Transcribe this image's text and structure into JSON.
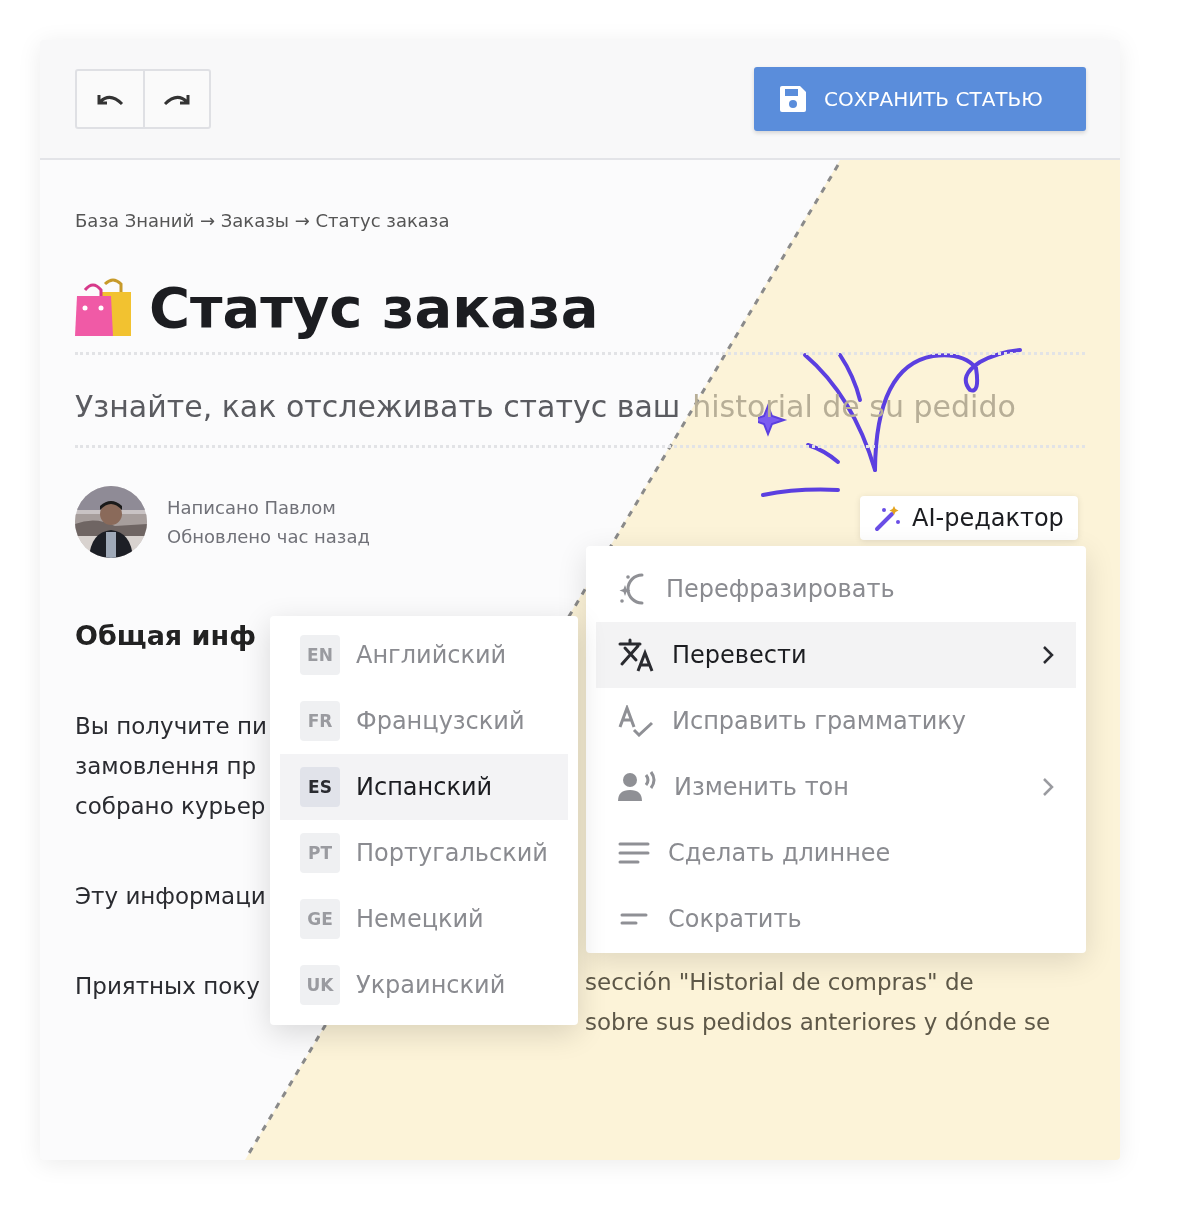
{
  "toolbar": {
    "save_button": "СОХРАНИТЬ СТАТЬЮ"
  },
  "breadcrumb": "База Знаний → Заказы → Статус заказа",
  "article": {
    "title": "Статус заказа",
    "subtitle": "Узнайте, как отслеживать статус ваш",
    "subtitle_translated": "historial de su pedido",
    "author": {
      "written_by": "Написано Павлом",
      "updated": "Обновлено час назад"
    },
    "section_heading": "Общая инф",
    "paragraphs": [
      [
        "Вы получите пи",
        "замовлення пр",
        "собрано курьер"
      ],
      [
        "Эту информаци"
      ],
      [
        "Приятных поку"
      ]
    ],
    "translated_lines": [
      "sección \"Historial de compras\" de",
      "sobre sus pedidos anteriores y dónde se"
    ]
  },
  "ai_editor": {
    "label": "AI-редактор"
  },
  "ai_menu": [
    {
      "kind": "rephrase",
      "label": "Перефразировать",
      "selected": false,
      "submenu": false
    },
    {
      "kind": "translate",
      "label": "Перевести",
      "selected": true,
      "submenu": true
    },
    {
      "kind": "grammar",
      "label": "Исправить грамматику",
      "selected": false,
      "submenu": false
    },
    {
      "kind": "tone",
      "label": "Изменить тон",
      "selected": false,
      "submenu": true
    },
    {
      "kind": "longer",
      "label": "Сделать длиннее",
      "selected": false,
      "submenu": false
    },
    {
      "kind": "shorter",
      "label": "Сократить",
      "selected": false,
      "submenu": false
    }
  ],
  "language_menu": [
    {
      "code": "EN",
      "label": "Английский",
      "selected": false
    },
    {
      "code": "FR",
      "label": "Французский",
      "selected": false
    },
    {
      "code": "ES",
      "label": "Испанский",
      "selected": true
    },
    {
      "code": "PT",
      "label": "Португальский",
      "selected": false
    },
    {
      "code": "GE",
      "label": "Немецкий",
      "selected": false
    },
    {
      "code": "UK",
      "label": "Украинский",
      "selected": false
    }
  ]
}
